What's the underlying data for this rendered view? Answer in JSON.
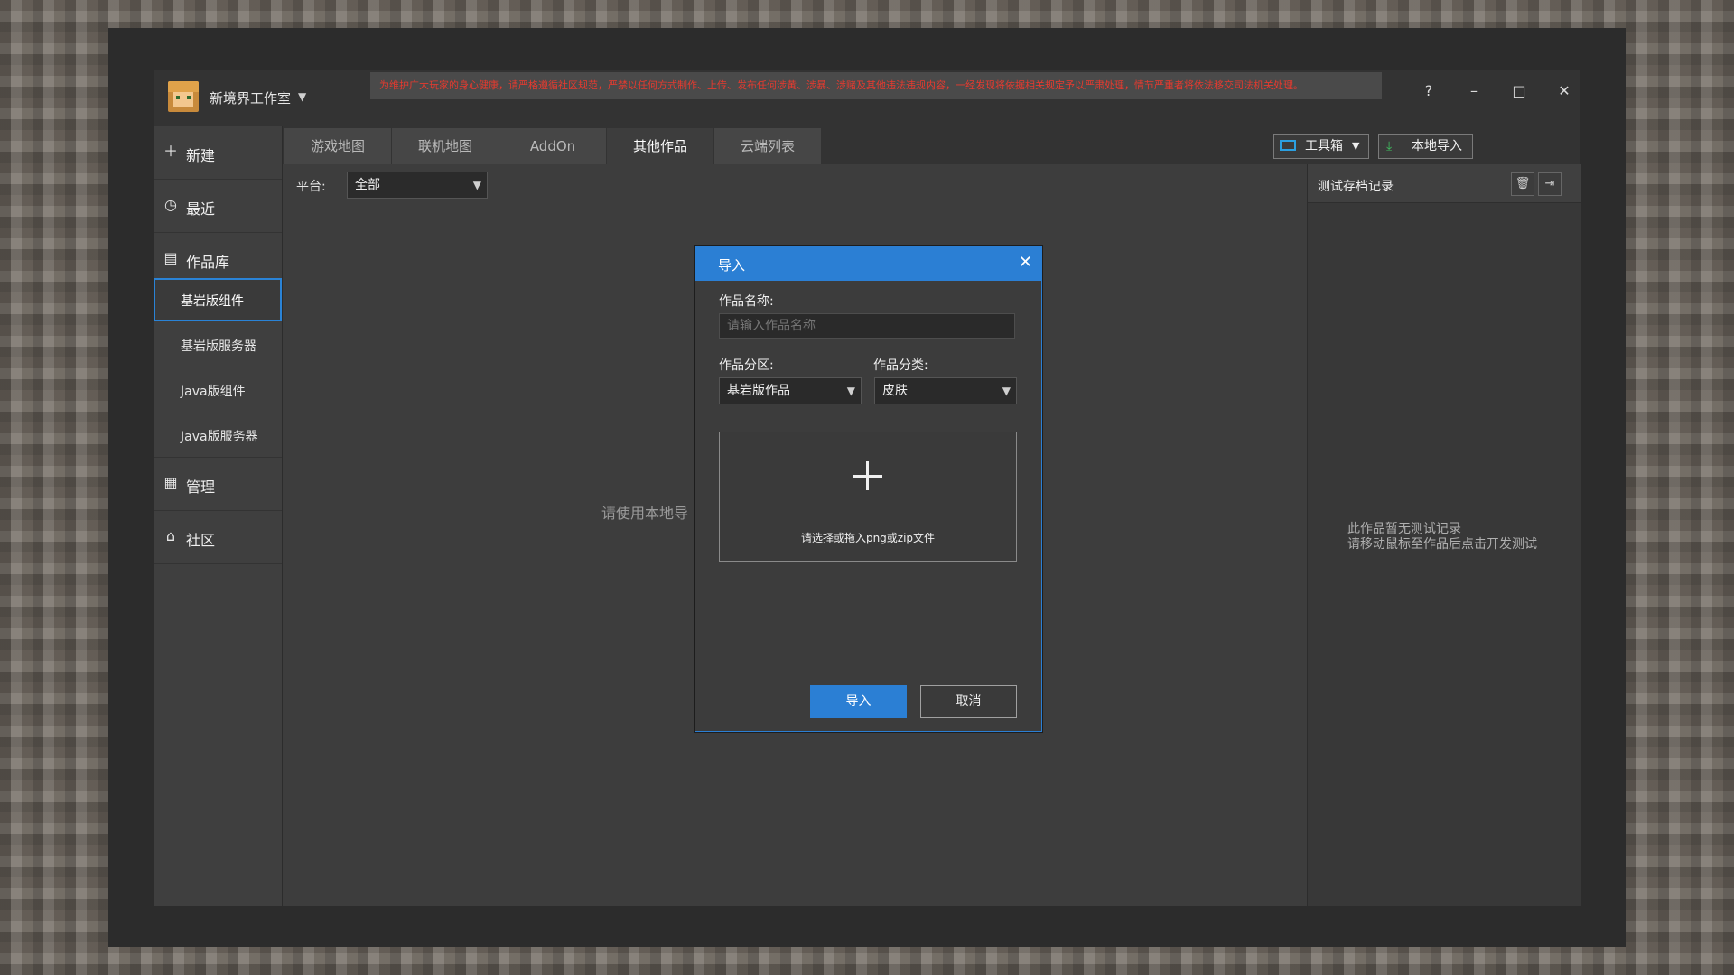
{
  "app": {
    "studio_name": "新境界工作室",
    "notice": "为维护广大玩家的身心健康，请严格遵循社区规范，严禁以任何方式制作、上传、发布任何涉黄、涉暴、涉赌及其他违法违规内容，一经发现将依据相关规定予以严肃处理，情节严重者将依法移交司法机关处理。"
  },
  "window_controls": {
    "help": "?",
    "minimize": "–",
    "maximize": "□",
    "close": "✕"
  },
  "nav": {
    "new": "新建",
    "recent": "最近",
    "library": "作品库",
    "library_items": [
      "基岩版组件",
      "基岩版服务器",
      "Java版组件",
      "Java版服务器"
    ],
    "manage": "管理",
    "community": "社区"
  },
  "tabs": [
    "游戏地图",
    "联机地图",
    "AddOn",
    "其他作品",
    "云端列表"
  ],
  "toolbar": {
    "toolbox": "工具箱",
    "local_import": "本地导入"
  },
  "filter": {
    "platform_label": "平台:",
    "platform_value": "全部"
  },
  "content_hint": "请使用本地导",
  "right_panel": {
    "title": "测试存档记录",
    "empty_line1": "此作品暂无测试记录",
    "empty_line2": "请移动鼠标至作品后点击开发测试"
  },
  "dialog": {
    "title": "导入",
    "name_label": "作品名称:",
    "name_placeholder": "请输入作品名称",
    "section_label": "作品分区:",
    "section_value": "基岩版作品",
    "category_label": "作品分类:",
    "category_value": "皮肤",
    "dropzone_text": "请选择或拖入png或zip文件",
    "ok": "导入",
    "cancel": "取消"
  },
  "colors": {
    "accent": "#2b7fd4",
    "notice_text": "#e53a2f"
  }
}
